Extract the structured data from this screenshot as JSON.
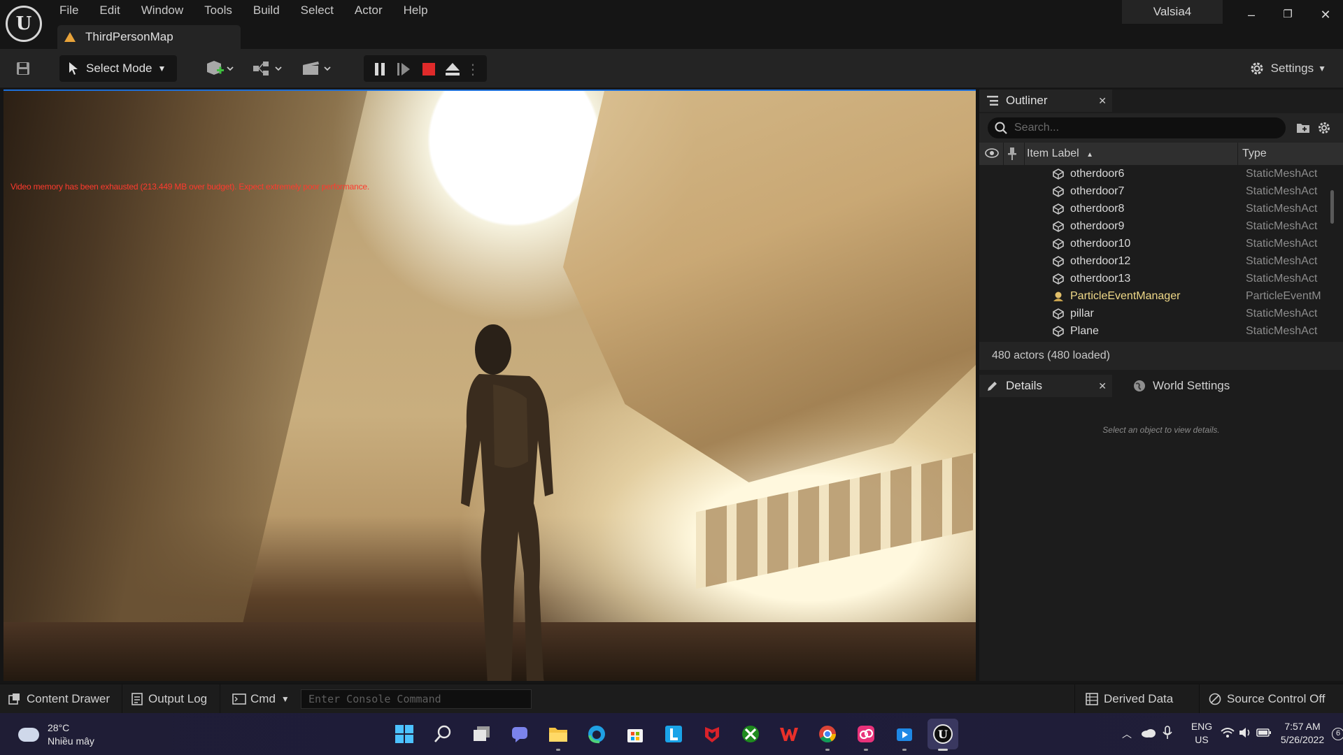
{
  "app": {
    "menu": [
      "File",
      "Edit",
      "Window",
      "Tools",
      "Build",
      "Select",
      "Actor",
      "Help"
    ],
    "map_tab": "ThirdPersonMap",
    "project": "Valsia4",
    "window_controls": {
      "minimize": "–",
      "restore": "❐",
      "close": "✕"
    }
  },
  "toolbar": {
    "select_mode": "Select Mode",
    "settings": "Settings"
  },
  "viewport": {
    "warning": "Video memory has been exhausted (213.449 MB over budget). Expect extremely poor performance."
  },
  "outliner": {
    "tab": "Outliner",
    "search_placeholder": "Search...",
    "col_label": "Item Label",
    "col_type": "Type",
    "rows": [
      {
        "label": "otherdoor6",
        "type": "StaticMeshAct",
        "icon": "static-mesh-icon"
      },
      {
        "label": "otherdoor7",
        "type": "StaticMeshAct",
        "icon": "static-mesh-icon"
      },
      {
        "label": "otherdoor8",
        "type": "StaticMeshAct",
        "icon": "static-mesh-icon"
      },
      {
        "label": "otherdoor9",
        "type": "StaticMeshAct",
        "icon": "static-mesh-icon"
      },
      {
        "label": "otherdoor10",
        "type": "StaticMeshAct",
        "icon": "static-mesh-icon"
      },
      {
        "label": "otherdoor12",
        "type": "StaticMeshAct",
        "icon": "static-mesh-icon"
      },
      {
        "label": "otherdoor13",
        "type": "StaticMeshAct",
        "icon": "static-mesh-icon"
      },
      {
        "label": "ParticleEventManager",
        "type": "ParticleEventM",
        "icon": "actor-pawn-icon"
      },
      {
        "label": "pillar",
        "type": "StaticMeshAct",
        "icon": "static-mesh-icon"
      },
      {
        "label": "Plane",
        "type": "StaticMeshAct",
        "icon": "static-mesh-icon"
      }
    ],
    "actor_count": "480 actors (480 loaded)"
  },
  "details": {
    "tab": "Details",
    "world_settings_tab": "World Settings",
    "empty_message": "Select an object to view details."
  },
  "statusbar": {
    "content_drawer": "Content Drawer",
    "output_log": "Output Log",
    "cmd": "Cmd",
    "console_placeholder": "Enter Console Command",
    "derived_data": "Derived Data",
    "source_control": "Source Control Off"
  },
  "taskbar": {
    "weather_temp": "28°C",
    "weather_desc": "Nhiều mây",
    "lang": "ENG",
    "region": "US",
    "time": "7:57 AM",
    "date": "5/26/2022",
    "notif_count": "6",
    "apps": [
      "windows-start-icon",
      "search-icon",
      "task-view-icon",
      "teams-chat-icon",
      "file-explorer-icon",
      "edge-icon",
      "store-icon",
      "launcher-l-icon",
      "mcafee-icon",
      "xbox-icon",
      "wps-office-icon",
      "chrome-icon",
      "creative-cloud-icon",
      "media-player-icon",
      "unreal-engine-icon"
    ]
  },
  "colors": {
    "accent": "#1d6fd8",
    "warning_text": "#ff3a2e",
    "stop_button": "#e02a2a",
    "map_tab_warning": "#e8a33a"
  }
}
